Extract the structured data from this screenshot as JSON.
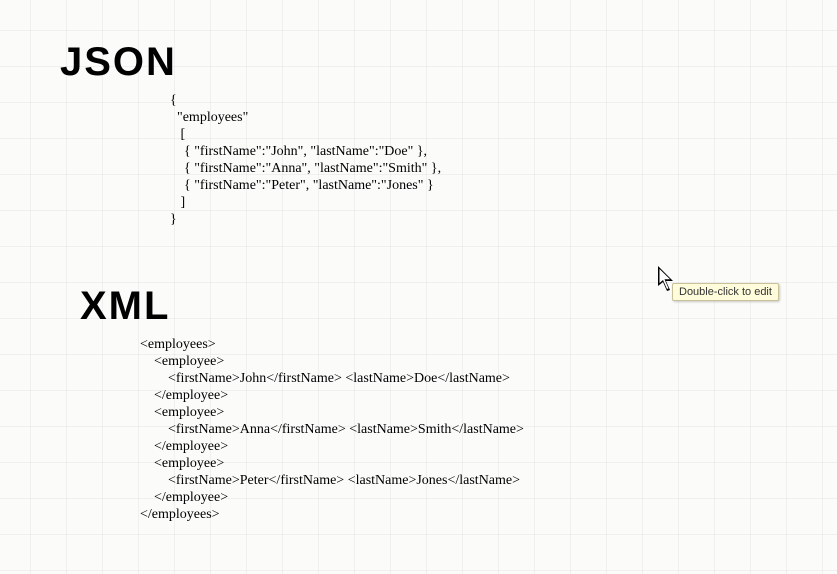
{
  "headings": {
    "json": "JSON",
    "xml": "XML"
  },
  "tooltip": "Double-click to edit",
  "json_code": "{\n  \"employees\"\n   [\n    { \"firstName\":\"John\", \"lastName\":\"Doe\" },\n    { \"firstName\":\"Anna\", \"lastName\":\"Smith\" },\n    { \"firstName\":\"Peter\", \"lastName\":\"Jones\" }\n   ]\n}",
  "xml_code": "<employees>\n    <employee>\n        <firstName>John</firstName> <lastName>Doe</lastName>\n    </employee>\n    <employee>\n        <firstName>Anna</firstName> <lastName>Smith</lastName>\n    </employee>\n    <employee>\n        <firstName>Peter</firstName> <lastName>Jones</lastName>\n    </employee>\n</employees>"
}
